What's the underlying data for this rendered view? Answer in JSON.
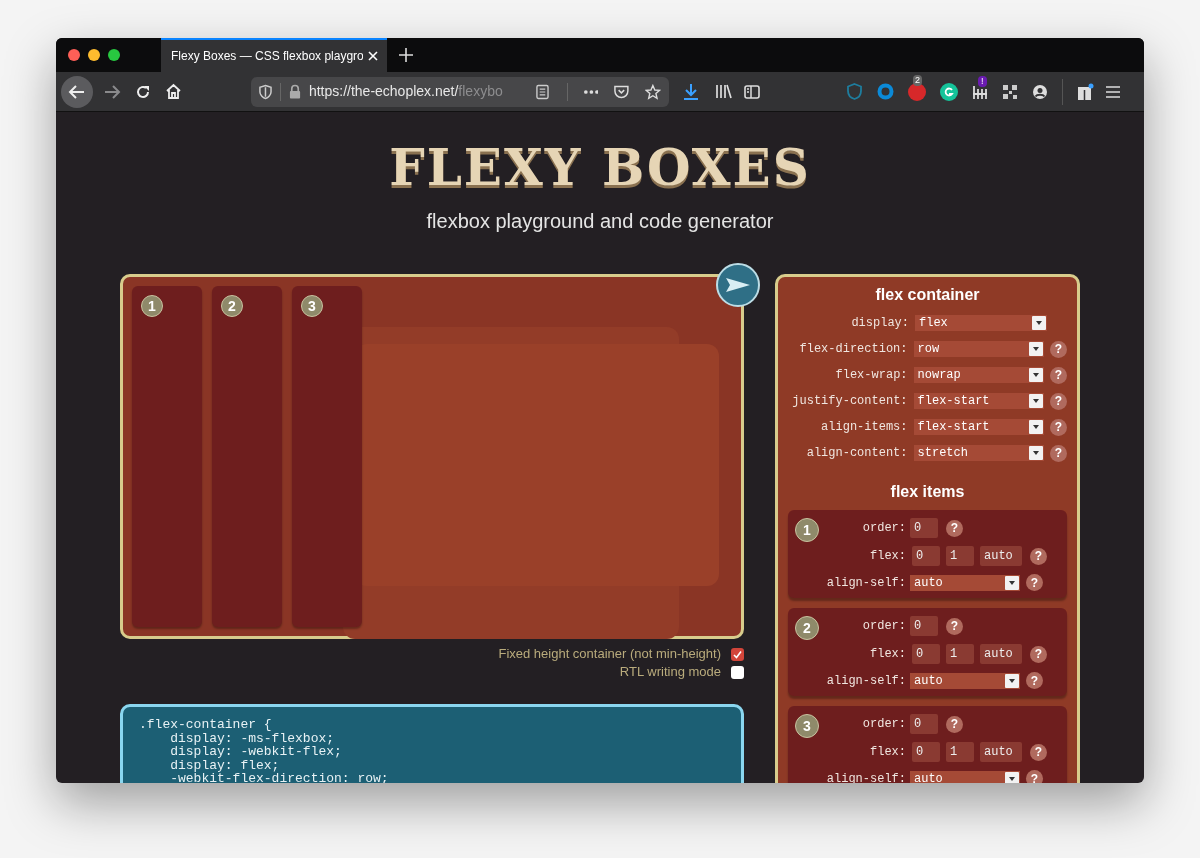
{
  "browser": {
    "tab_title": "Flexy Boxes — CSS flexbox playgro",
    "url_host": "https://the-echoplex.net/",
    "url_path": "flexybo",
    "extension_badges": [
      "2",
      "!"
    ]
  },
  "page": {
    "title": "FLEXY BOXES",
    "subtitle": "flexbox playground and code generator"
  },
  "playground": {
    "items": [
      {
        "label": "1"
      },
      {
        "label": "2"
      },
      {
        "label": "3"
      }
    ]
  },
  "options": [
    {
      "label": "Fixed height container (not min-height)",
      "checked": true
    },
    {
      "label": "RTL writing mode",
      "checked": false
    }
  ],
  "code": [
    ".flex-container {",
    "    display: -ms-flexbox;",
    "    display: -webkit-flex;",
    "    display: flex;",
    "    -webkit-flex-direction: row;"
  ],
  "panel": {
    "container_title": "flex container",
    "container_props": [
      {
        "label": "display:",
        "value": "flex"
      },
      {
        "label": "flex-direction:",
        "value": "row",
        "help": "?"
      },
      {
        "label": "flex-wrap:",
        "value": "nowrap",
        "help": "?"
      },
      {
        "label": "justify-content:",
        "value": "flex-start",
        "help": "?"
      },
      {
        "label": "align-items:",
        "value": "flex-start",
        "help": "?"
      },
      {
        "label": "align-content:",
        "value": "stretch",
        "help": "?"
      }
    ],
    "items_title": "flex items",
    "items": [
      {
        "number": "1",
        "order_label": "order:",
        "order": "0",
        "flex_label": "flex:",
        "flex": [
          "0",
          "1",
          "auto"
        ],
        "align_label": "align-self:",
        "align_self": "auto",
        "help": "?"
      },
      {
        "number": "2",
        "order_label": "order:",
        "order": "0",
        "flex_label": "flex:",
        "flex": [
          "0",
          "1",
          "auto"
        ],
        "align_label": "align-self:",
        "align_self": "auto",
        "help": "?"
      },
      {
        "number": "3",
        "order_label": "order:",
        "order": "0",
        "flex_label": "flex:",
        "flex": [
          "0",
          "1",
          "auto"
        ],
        "align_label": "align-self:",
        "align_self": "auto",
        "help": "?"
      }
    ]
  }
}
